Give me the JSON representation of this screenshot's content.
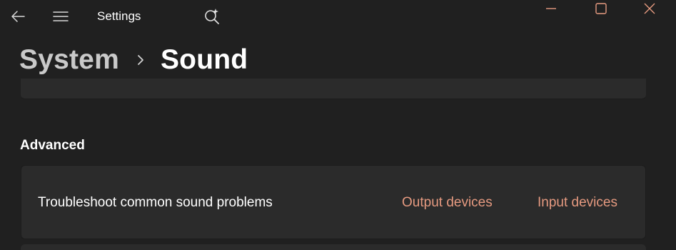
{
  "titlebar": {
    "app_title": "Settings",
    "back_icon": "back-arrow-icon",
    "menu_icon": "hamburger-menu-icon",
    "search_icon": "search-sparkle-icon",
    "minimize_icon": "minimize-icon",
    "maximize_icon": "maximize-icon",
    "close_icon": "close-icon",
    "caption_color": "#e69a80"
  },
  "breadcrumb": {
    "parent": "System",
    "current": "Sound"
  },
  "advanced": {
    "header": "Advanced",
    "troubleshoot": {
      "label": "Troubleshoot common sound problems",
      "output_link": "Output devices",
      "input_link": "Input devices"
    }
  },
  "colors": {
    "background": "#202020",
    "card": "#2b2b2b",
    "accent_link": "#e69a80"
  }
}
